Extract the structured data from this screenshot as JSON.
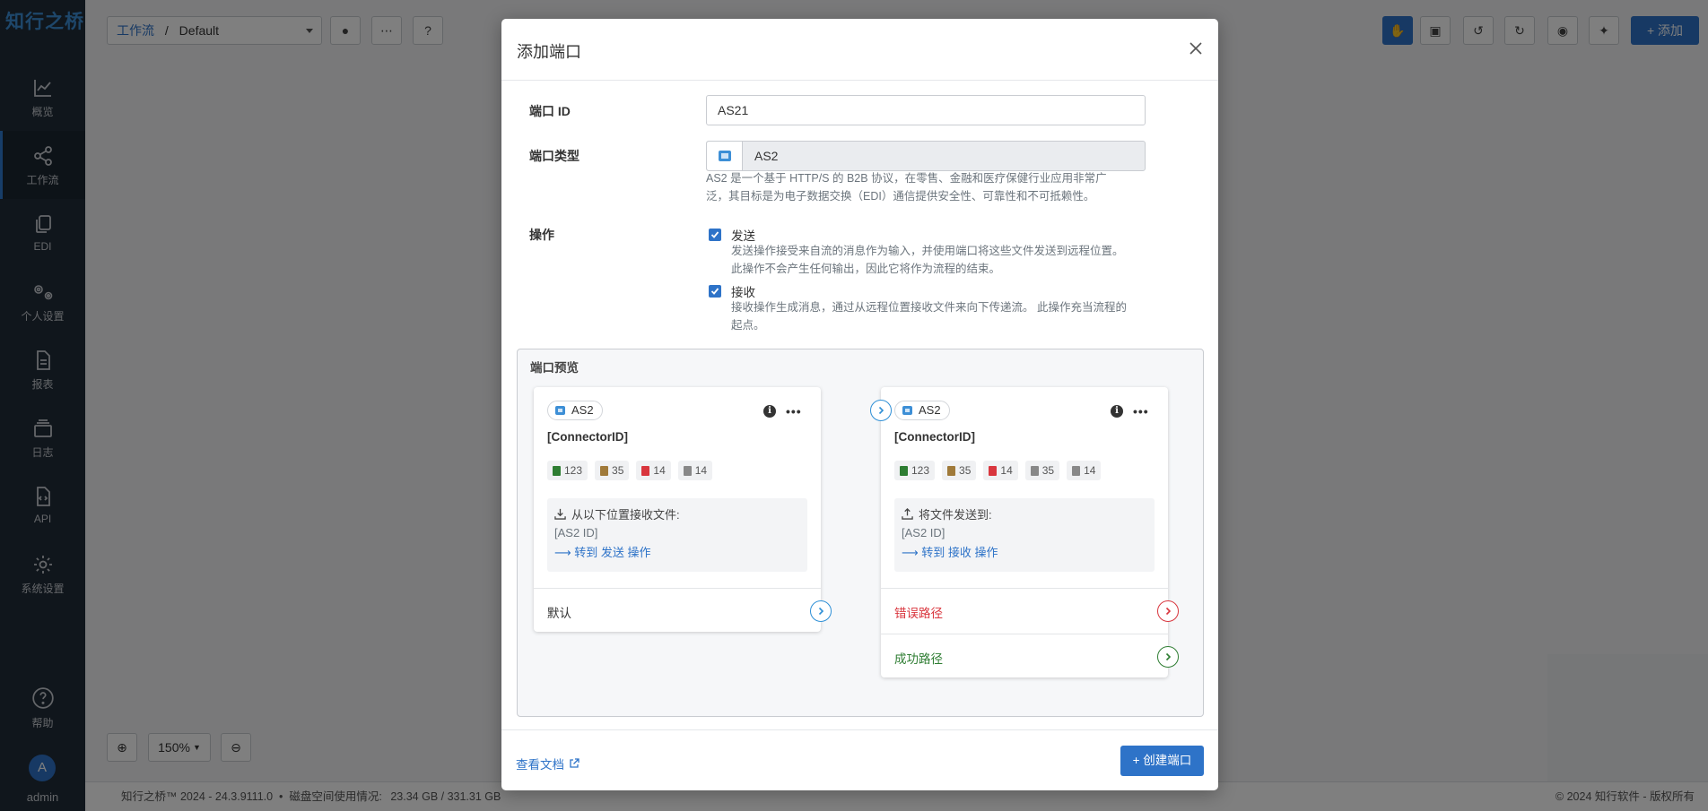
{
  "app": {
    "logo_text": "知行之桥"
  },
  "sidebar": {
    "items": [
      {
        "label": "概览",
        "icon": "chart-line-icon"
      },
      {
        "label": "工作流",
        "icon": "share-nodes-icon",
        "active": true
      },
      {
        "label": "EDI",
        "icon": "copy-icon"
      },
      {
        "label": "个人设置",
        "icon": "gears-icon"
      },
      {
        "label": "报表",
        "icon": "file-icon"
      },
      {
        "label": "日志",
        "icon": "layers-icon"
      },
      {
        "label": "API",
        "icon": "code-file-icon"
      },
      {
        "label": "系统设置",
        "icon": "gear-icon"
      }
    ],
    "help_label": "帮助",
    "user": {
      "initial": "A",
      "name": "admin"
    }
  },
  "toolbar": {
    "breadcrumb_link": "工作流",
    "breadcrumb_sep": "/",
    "workspace": "Default",
    "add_label": "+ 添加"
  },
  "zoom": {
    "level": "150%"
  },
  "footer": {
    "version": "知行之桥™ 2024 - 24.3.9111.0",
    "disk_label": "磁盘空间使用情况:",
    "disk_value": "23.34 GB / 331.31 GB",
    "copyright": "© 2024 知行软件 - 版权所有"
  },
  "modal": {
    "title": "添加端口",
    "port_id_label": "端口 ID",
    "port_id_value": "AS21",
    "port_type_label": "端口类型",
    "port_type_value": "AS2",
    "port_type_help_1": "AS2 是一个基于 HTTP/S 的 B2B 协议，在零售、金融和医疗保健行业应用非常广",
    "port_type_help_2": "泛，其目标是为电子数据交换（EDI）通信提供安全性、可靠性和不可抵赖性。",
    "ops_label": "操作",
    "send_label": "发送",
    "send_desc_1": "发送操作接受来自流的消息作为输入，并使用端口将这些文件发送到远程位置。",
    "send_desc_2": "此操作不会产生任何输出，因此它将作为流程的结束。",
    "receive_label": "接收",
    "receive_desc_1": "接收操作生成消息，通过从远程位置接收文件来向下传递流。 此操作充当流程的",
    "receive_desc_2": "起点。",
    "preview_title": "端口预览",
    "doc_link": "查看文档",
    "create_label": "+ 创建端口"
  },
  "cards": {
    "left": {
      "tag": "AS2",
      "title": "[ConnectorID]",
      "stats": [
        "123",
        "35",
        "14",
        "14"
      ],
      "line1": "从以下位置接收文件:",
      "line2": "[AS2 ID]",
      "line3": "⟶ 转到 发送 操作",
      "path1": "默认"
    },
    "right": {
      "tag": "AS2",
      "title": "[ConnectorID]",
      "stats": [
        "123",
        "35",
        "14",
        "35",
        "14"
      ],
      "line1": "将文件发送到:",
      "line2": "[AS2 ID]",
      "line3": "⟶ 转到 接收 操作",
      "path1": "错误路径",
      "path2": "成功路径"
    }
  },
  "colors": {
    "accent": "#2e73c8",
    "error": "#d9363e",
    "success": "#2e7d32",
    "sidebar_bg": "#202c38"
  }
}
